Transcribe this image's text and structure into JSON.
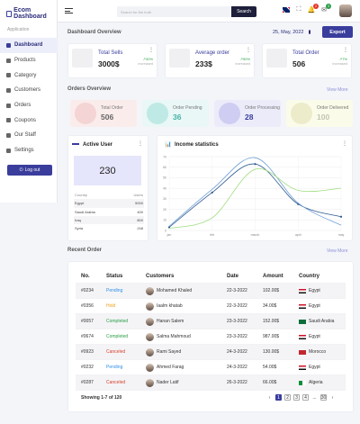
{
  "brand": {
    "name": "Ecom Dashboard",
    "accent": "#3a3d9c"
  },
  "sidebar": {
    "heading": "Application",
    "items": [
      {
        "label": "Dashboard",
        "icon": "dashboard-icon",
        "active": true
      },
      {
        "label": "Products",
        "icon": "products-icon"
      },
      {
        "label": "Category",
        "icon": "category-icon"
      },
      {
        "label": "Customers",
        "icon": "customers-icon"
      },
      {
        "label": "Orders",
        "icon": "orders-icon"
      },
      {
        "label": "Coupons",
        "icon": "coupons-icon"
      },
      {
        "label": "Our Staff",
        "icon": "staff-icon"
      },
      {
        "label": "Settings",
        "icon": "settings-icon"
      }
    ],
    "logout": "Log out"
  },
  "topbar": {
    "search_placeholder": "Search for the truth",
    "search_button": "Search",
    "notif_count": "2",
    "messages_count": "3"
  },
  "overview": {
    "title": "Dashboard Overview",
    "date": "25, May, 2022",
    "export": "Export",
    "stats": [
      {
        "label": "Total Sells",
        "value": "3000$",
        "pct": "↗30%",
        "sub": "increased"
      },
      {
        "label": "Average order",
        "value": "233$",
        "pct": "↗50%",
        "sub": "increased"
      },
      {
        "label": "Total Order",
        "value": "506",
        "pct": "↗7%",
        "sub": "increased"
      }
    ]
  },
  "orders_overview": {
    "title": "Orders Overview",
    "view_more": "View More",
    "cards": [
      {
        "label": "Total Order",
        "value": "506",
        "bg": "#fbecec",
        "circle": "#f4d4d4",
        "color": "#666"
      },
      {
        "label": "Order Pending",
        "value": "36",
        "bg": "#e9f7f6",
        "circle": "#bfe9e4",
        "color": "#43b3a6"
      },
      {
        "label": "Order Processing",
        "value": "28",
        "bg": "#ecebfa",
        "circle": "#cfcdf2",
        "color": "#3a3d9c"
      },
      {
        "label": "Order Delivered",
        "value": "100",
        "bg": "#fbfbe9",
        "circle": "#ececcb",
        "color": "#c4c4b3"
      }
    ]
  },
  "active_user": {
    "title": "Active User",
    "value": "230",
    "table_header": [
      "Country",
      "Users"
    ],
    "rows": [
      [
        "Egypt",
        "5000"
      ],
      [
        "Saudi Arabia",
        "400"
      ],
      [
        "Iraq",
        "800"
      ],
      [
        "Syria",
        "248"
      ]
    ]
  },
  "income": {
    "title": "Income statistics"
  },
  "chart_data": {
    "type": "line",
    "title": "Income statistics",
    "categories": [
      "jan",
      "feb",
      "march",
      "april",
      "may"
    ],
    "ylim": [
      0,
      70
    ],
    "yticks": [
      0,
      10,
      20,
      30,
      40,
      50,
      60,
      70
    ],
    "series": [
      {
        "values": [
          3,
          36,
          63,
          25,
          13
        ],
        "color": "#2f5a8f"
      },
      {
        "values": [
          4,
          39,
          69,
          26,
          5
        ],
        "color": "#6fa0d6"
      },
      {
        "values": [
          2,
          12,
          58,
          38,
          40
        ],
        "color": "#9fdc7f"
      }
    ]
  },
  "recent": {
    "title": "Recent Order",
    "view_more": "View More",
    "columns": [
      "No.",
      "Status",
      "Customers",
      "Date",
      "Amount",
      "Country"
    ],
    "rows": [
      {
        "no": "#0234",
        "status": "Pending",
        "customer": "Mohamed Khaled",
        "date": "22-3-2022",
        "amount": "102.00$",
        "country": "Egypt",
        "flag": "egypt"
      },
      {
        "no": "#0356",
        "status": "Hold",
        "customer": "Iaalm khatab",
        "date": "22-3-2022",
        "amount": "34.00$",
        "country": "Egypt",
        "flag": "egypt"
      },
      {
        "no": "#0057",
        "status": "Completed",
        "customer": "Hanan Salem",
        "date": "23-3-2022",
        "amount": "152.00$",
        "country": "Saudi Arabia",
        "flag": "saudi"
      },
      {
        "no": "#0674",
        "status": "Completed",
        "customer": "Salma Mahmoud",
        "date": "23-3-2022",
        "amount": "987.00$",
        "country": "Egypt",
        "flag": "egypt"
      },
      {
        "no": "#0923",
        "status": "Canceled",
        "customer": "Rami Sayed",
        "date": "24-3-2022",
        "amount": "130.00$",
        "country": "Morocco",
        "flag": "morocco"
      },
      {
        "no": "#0232",
        "status": "Pending",
        "customer": "Ahmed Farag",
        "date": "24-3-2022",
        "amount": "54.00$",
        "country": "Egypt",
        "flag": "egypt"
      },
      {
        "no": "#0287",
        "status": "Canceled",
        "customer": "Nader Latif",
        "date": "26-3-2022",
        "amount": "66.00$",
        "country": "Algeria",
        "flag": "algeria"
      }
    ],
    "status_colors": {
      "Pending": "#2f8fe6",
      "Hold": "#f0a21a",
      "Completed": "#2a9d49",
      "Canceled": "#d93c2a"
    },
    "showing": "Showing 1-7 of 120",
    "pages": [
      "1",
      "2",
      "3",
      "4",
      "...",
      "30"
    ]
  }
}
